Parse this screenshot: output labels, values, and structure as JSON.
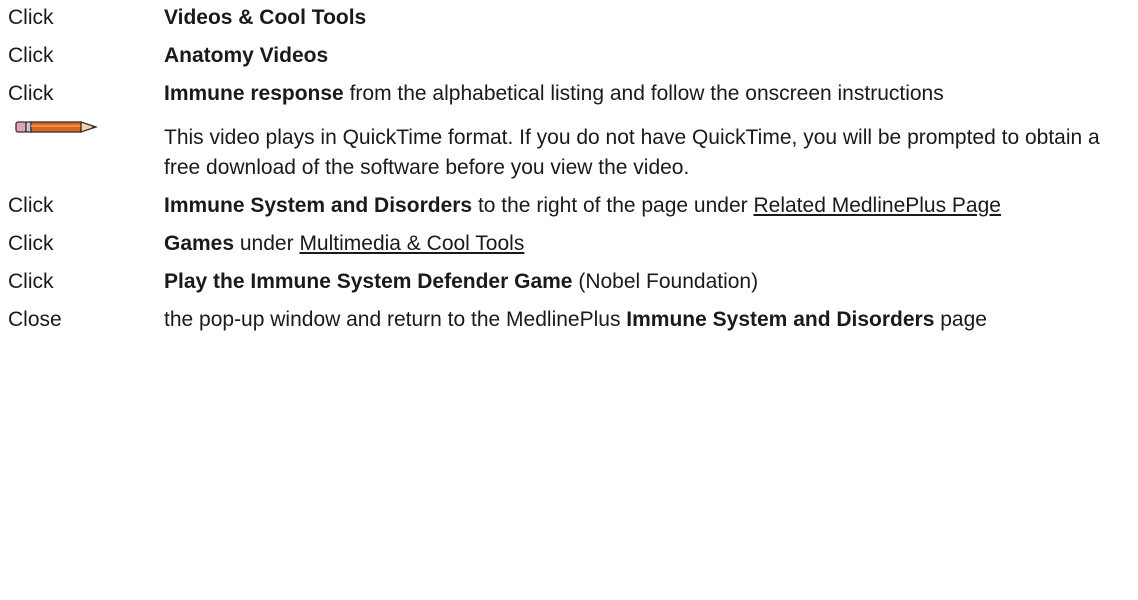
{
  "steps": [
    {
      "action": "Click",
      "bold": "Videos & Cool Tools"
    },
    {
      "action": "Click",
      "bold": "Anatomy Videos"
    },
    {
      "action": "Click",
      "bold": "Immune response",
      "rest": " from the alphabetical listing and follow the onscreen instructions"
    },
    {
      "action": "Click",
      "bold": "Immune System and Disorders",
      "mid": " to the right of the page under ",
      "link": "Related MedlinePlus Page"
    },
    {
      "action": "Click",
      "bold": "Games",
      "mid": " under ",
      "link": "Multimedia & Cool Tools"
    },
    {
      "action": "Click",
      "bold": "Play the Immune System Defender Game",
      "rest": " (Nobel Foundation)"
    },
    {
      "action": "Close",
      "pre": "the pop-up window and return to the MedlinePlus ",
      "bold": "Immune System and Disorders",
      "rest": " page"
    }
  ],
  "note": {
    "icon": "pencil-icon",
    "text": "This video plays in QuickTime format. If you do not have QuickTime, you will be prompted to obtain a free download of the software before you view the video."
  },
  "colors": {
    "text": "#1a1a1a",
    "pencil_body": "#d9661f",
    "pencil_eraser": "#e8a0b8",
    "pencil_tip": "#f2d2a9"
  }
}
